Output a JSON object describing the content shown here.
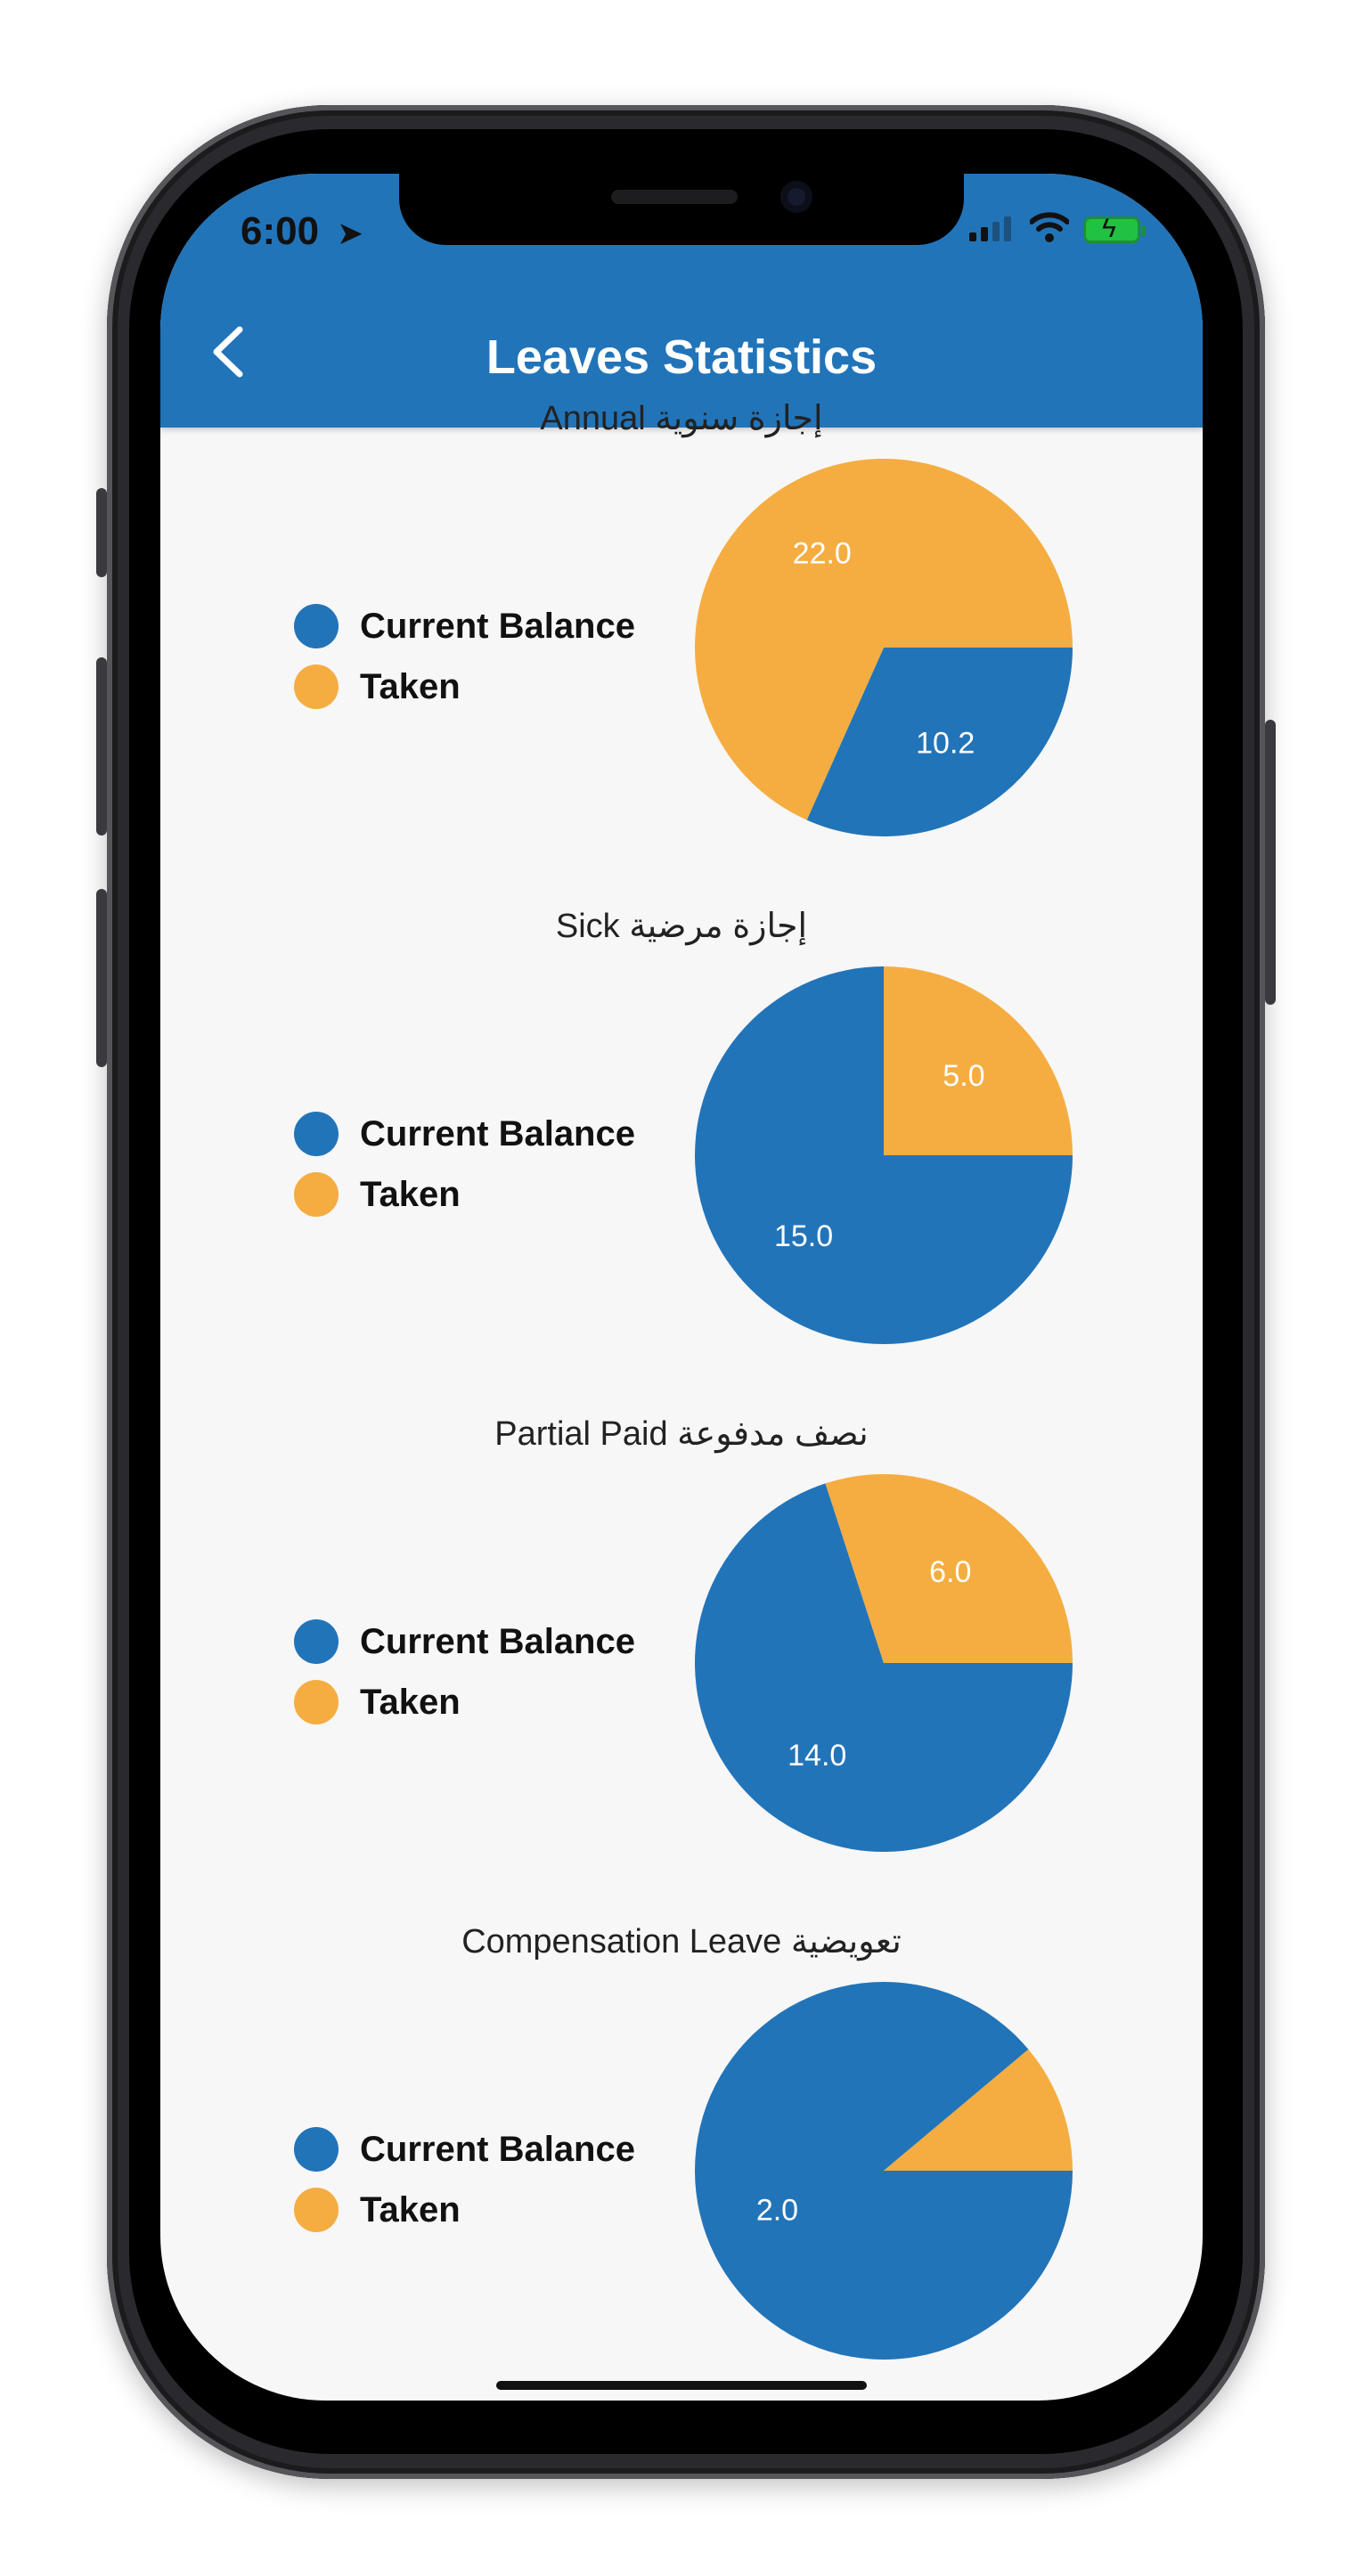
{
  "status_bar": {
    "time": "6:00"
  },
  "header": {
    "title": "Leaves Statistics",
    "back_icon": "chevron-left-icon"
  },
  "colors": {
    "accent": "#2274b9",
    "balance": "#2274b9",
    "taken": "#f5ad41"
  },
  "legend": {
    "current_balance": "Current Balance",
    "taken": "Taken"
  },
  "chart_data": [
    {
      "type": "pie",
      "title": "Annual إجازة سنوية",
      "categories": [
        "Current Balance",
        "Taken"
      ],
      "values": [
        10.2,
        22.0
      ],
      "labels": [
        "10.2",
        "22.0"
      ]
    },
    {
      "type": "pie",
      "title": "Sick إجازة مرضية",
      "categories": [
        "Current Balance",
        "Taken"
      ],
      "values": [
        15.0,
        5.0
      ],
      "labels": [
        "15.0",
        "5.0"
      ]
    },
    {
      "type": "pie",
      "title": "Partial Paid نصف مدفوعة",
      "categories": [
        "Current Balance",
        "Taken"
      ],
      "values": [
        14.0,
        6.0
      ],
      "labels": [
        "14.0",
        "6.0"
      ]
    },
    {
      "type": "pie",
      "title": "Compensation Leave تعويضية",
      "categories": [
        "Current Balance",
        "Taken"
      ],
      "values": [
        2.0,
        0.25
      ],
      "labels": [
        "2.0",
        ""
      ]
    }
  ]
}
